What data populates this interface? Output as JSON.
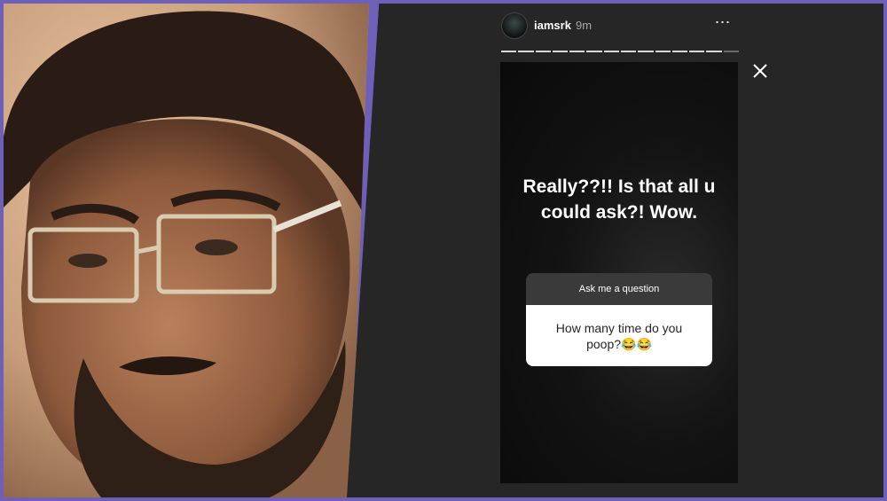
{
  "story": {
    "username": "iamsrk",
    "time": "9m",
    "more_icon": "⋯",
    "progress_segments": 14,
    "active_segments": 13,
    "text": "Really??!! Is that all u could ask?! Wow.",
    "question_sticker": {
      "header": "Ask me a question",
      "question": "How many time do you poop?😂😂"
    }
  },
  "colors": {
    "frame": "#6e5fb8",
    "story_bg": "#262626",
    "card_bg": "#0a0a0a",
    "sticker_head": "#3a3a3a",
    "sticker_body": "#ffffff"
  },
  "icons": {
    "more": "more-options-icon",
    "close": "close-icon",
    "avatar": "avatar"
  }
}
